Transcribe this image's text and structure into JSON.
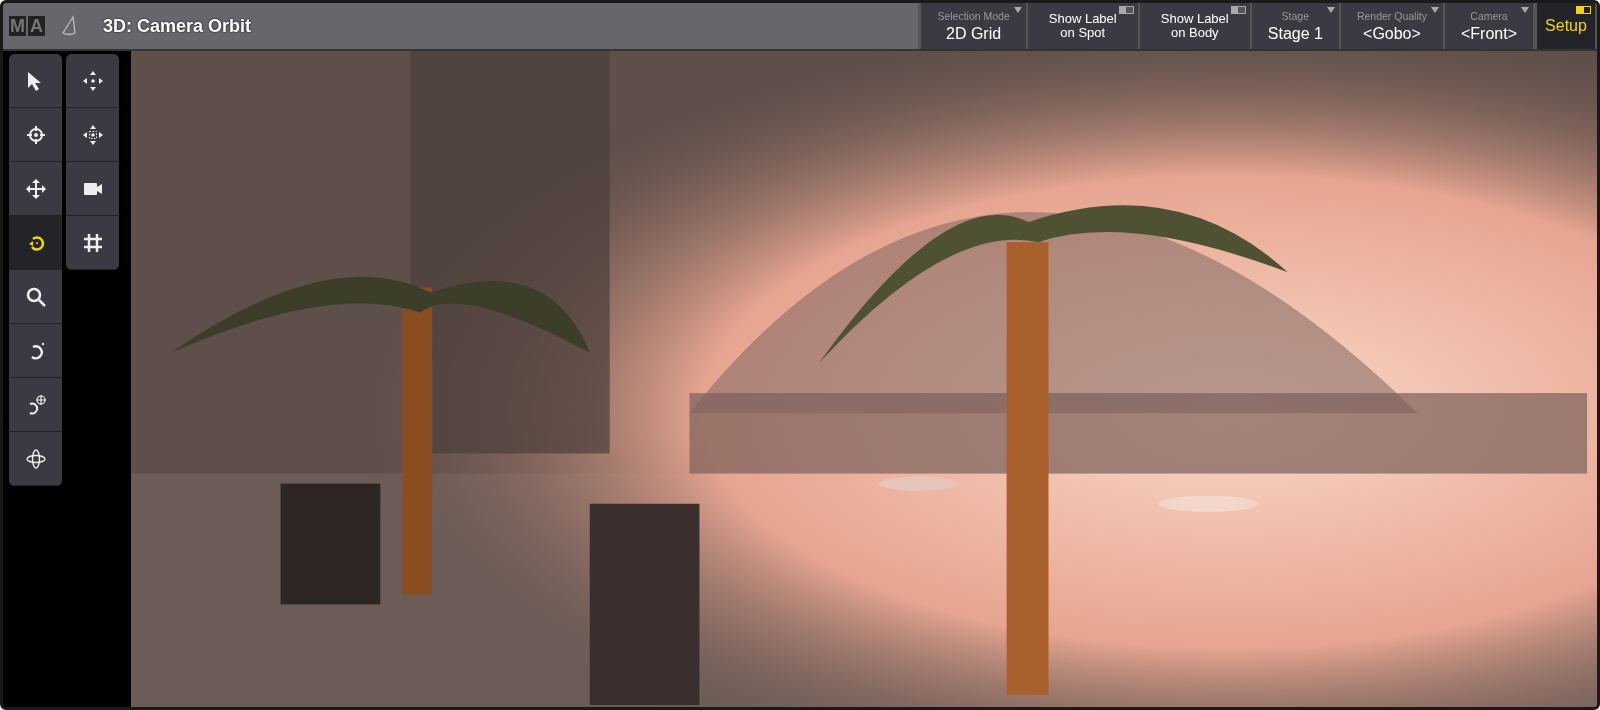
{
  "window": {
    "title": "3D: Camera Orbit",
    "logo": [
      "M",
      "A"
    ]
  },
  "toolbar": [
    {
      "kind": "select",
      "label": "Selection Mode",
      "value": "2D Grid"
    },
    {
      "kind": "toggle",
      "label": "Show Label on Spot",
      "on": false
    },
    {
      "kind": "toggle",
      "label": "Show Label on Body",
      "on": false
    },
    {
      "kind": "select",
      "label": "Stage",
      "value": "Stage 1"
    },
    {
      "kind": "select",
      "label": "Render Quality",
      "value": "<Gobo>"
    },
    {
      "kind": "select",
      "label": "Camera",
      "value": "<Front>"
    },
    {
      "kind": "setup",
      "label": "Setup"
    }
  ],
  "tools_left": [
    {
      "selected": false
    },
    {
      "selected": false
    },
    {
      "selected": false
    },
    {
      "selected": true
    },
    {
      "selected": false
    },
    {
      "selected": false
    },
    {
      "selected": false
    },
    {
      "selected": false
    }
  ],
  "tools_right": [
    {
      "selected": false
    },
    {
      "selected": false
    },
    {
      "selected": false
    },
    {
      "selected": false
    }
  ]
}
